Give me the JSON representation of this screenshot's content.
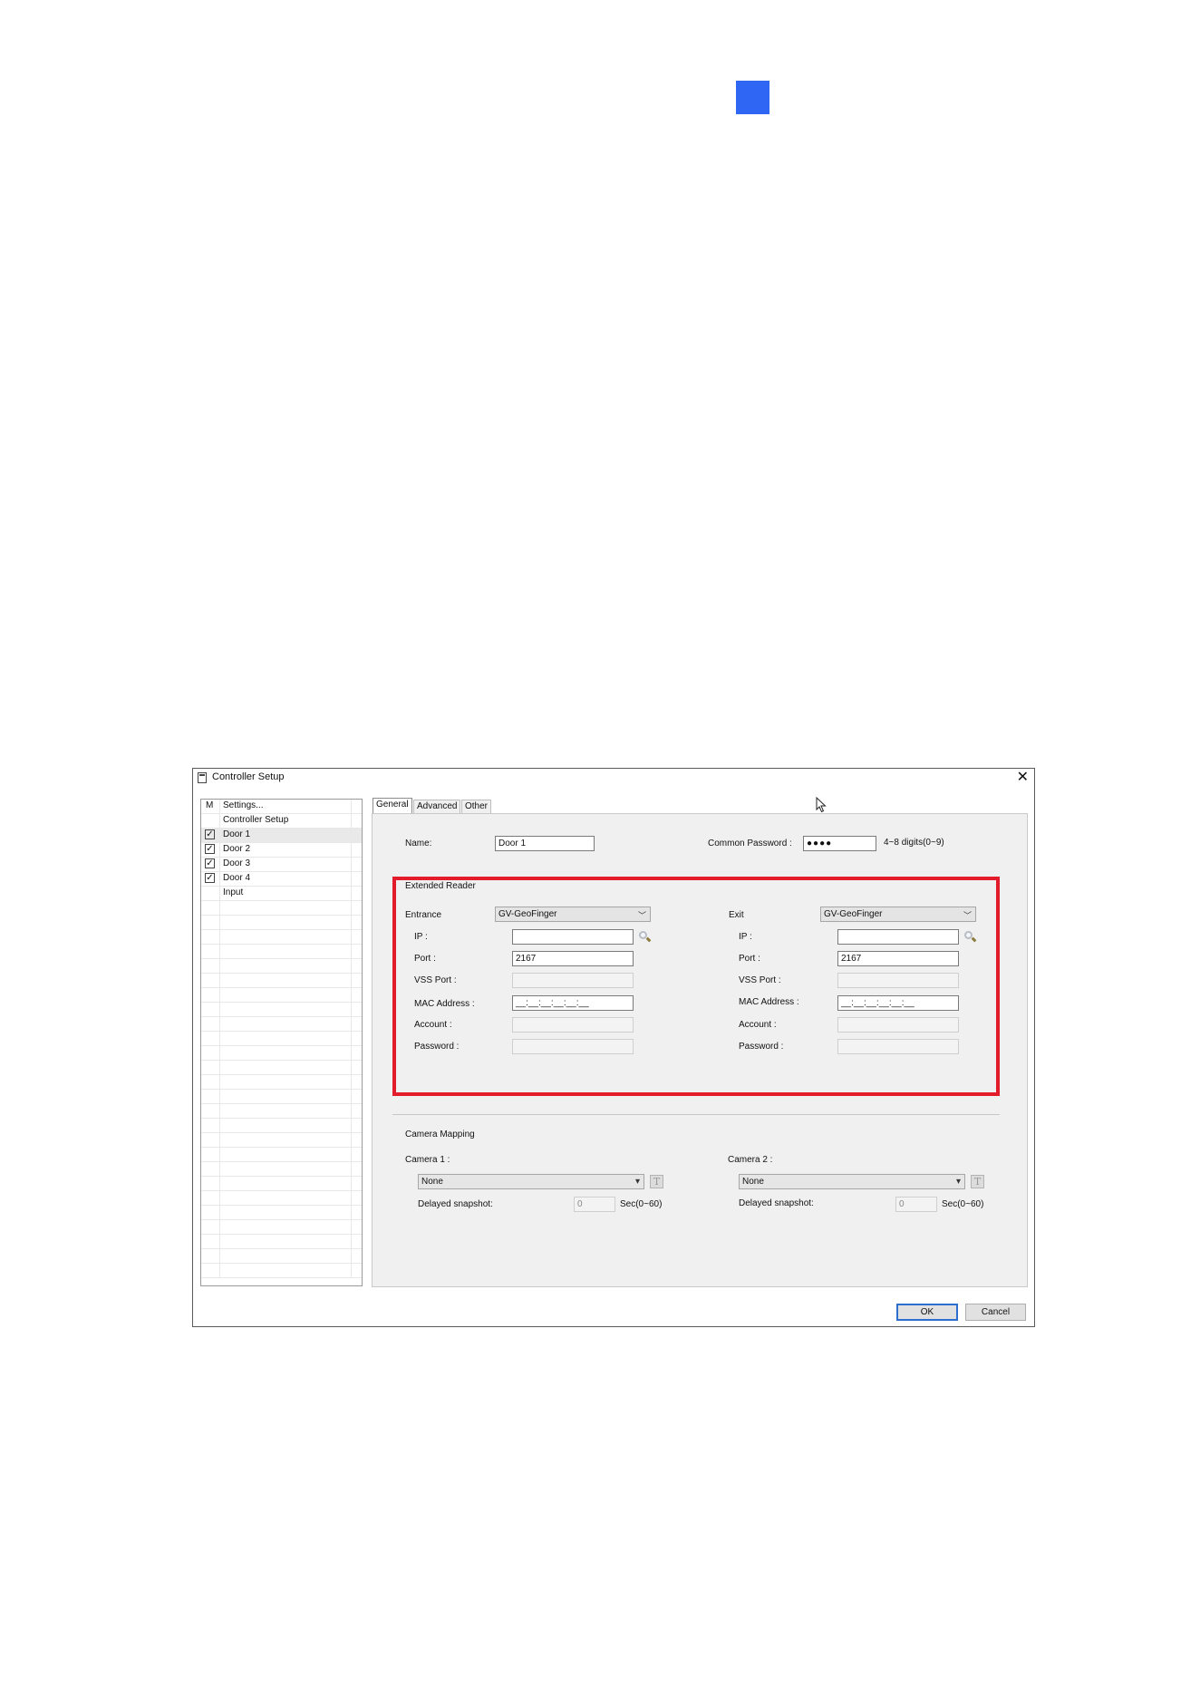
{
  "window": {
    "title": "Controller Setup",
    "close_glyph": "✕"
  },
  "tree": {
    "header_col": "M",
    "rows": [
      {
        "label": "Settings...",
        "checked": null
      },
      {
        "label": "Controller Setup",
        "checked": null
      },
      {
        "label": "Door 1",
        "checked": true
      },
      {
        "label": "Door 2",
        "checked": true
      },
      {
        "label": "Door 3",
        "checked": true
      },
      {
        "label": "Door 4",
        "checked": true
      },
      {
        "label": "Input",
        "checked": null
      }
    ]
  },
  "tabs": [
    {
      "label": "General",
      "active": true
    },
    {
      "label": "Advanced",
      "active": false
    },
    {
      "label": "Other",
      "active": false
    }
  ],
  "general": {
    "name_label": "Name:",
    "name_value": "Door 1",
    "common_password_label": "Common Password :",
    "common_password_value": "●●●●",
    "password_hint": "4~8 digits(0~9)"
  },
  "extended_reader": {
    "title": "Extended Reader",
    "entrance": {
      "label": "Entrance",
      "reader": "GV-GeoFinger",
      "ip_label": "IP :",
      "ip_value": "",
      "port_label": "Port :",
      "port_value": "2167",
      "vss_port_label": "VSS Port :",
      "vss_port_value": "",
      "mac_label": "MAC Address :",
      "mac_value": "__:__:__:__:__:__",
      "account_label": "Account :",
      "account_value": "",
      "password_label": "Password :",
      "password_value": ""
    },
    "exit": {
      "label": "Exit",
      "reader": "GV-GeoFinger",
      "ip_label": "IP :",
      "ip_value": "",
      "port_label": "Port :",
      "port_value": "2167",
      "vss_port_label": "VSS Port :",
      "vss_port_value": "",
      "mac_label": "MAC Address :",
      "mac_value": "__:__:__:__:__:__",
      "account_label": "Account :",
      "account_value": "",
      "password_label": "Password :",
      "password_value": ""
    }
  },
  "camera_mapping": {
    "title": "Camera Mapping",
    "camera1": {
      "label": "Camera 1 :",
      "value": "None",
      "delay_label": "Delayed snapshot:",
      "delay_value": "0",
      "delay_unit": "Sec(0~60)"
    },
    "camera2": {
      "label": "Camera 2 :",
      "value": "None",
      "delay_label": "Delayed snapshot:",
      "delay_value": "0",
      "delay_unit": "Sec(0~60)"
    }
  },
  "buttons": {
    "ok": "OK",
    "cancel": "Cancel"
  },
  "colors": {
    "highlight": "#e21c2a",
    "page_marker": "#2f66f4",
    "default_button_border": "#2d6fcf"
  },
  "icons": {
    "search": "search-icon",
    "text": "text-icon",
    "checkbox": "checkbox-checked-icon"
  }
}
